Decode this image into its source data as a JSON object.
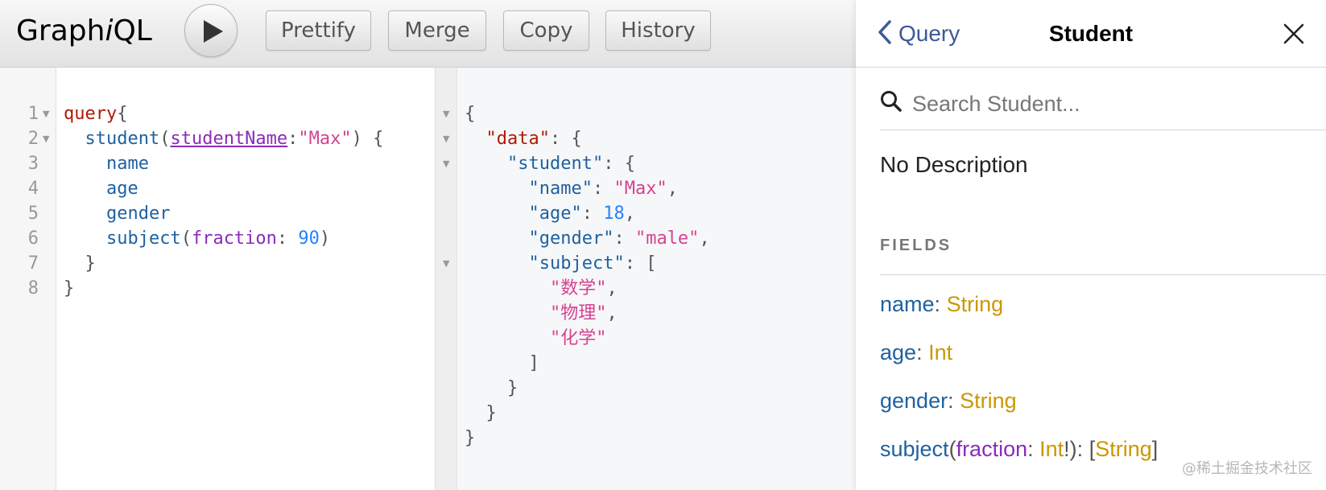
{
  "toolbar": {
    "logo_pre": "Graph",
    "logo_i": "i",
    "logo_post": "QL",
    "buttons": {
      "prettify": "Prettify",
      "merge": "Merge",
      "copy": "Copy",
      "history": "History"
    }
  },
  "query_editor": {
    "line_numbers": [
      "1",
      "2",
      "3",
      "4",
      "5",
      "6",
      "7",
      "8"
    ],
    "lines": {
      "l1_kw": "query",
      "l1_brace": "{",
      "l2_field": "student",
      "l2_open": "(",
      "l2_arg": "studentName",
      "l2_colon": ":",
      "l2_val": "\"Max\"",
      "l2_close": ") {",
      "l3": "name",
      "l4": "age",
      "l5": "gender",
      "l6_field": "subject",
      "l6_open": "(",
      "l6_arg": "fraction",
      "l6_colon": ": ",
      "l6_val": "90",
      "l6_close": ")",
      "l7": "}",
      "l8": "}"
    }
  },
  "result": {
    "open": "{",
    "data_key": "\"data\"",
    "colon": ": ",
    "brace_open": "{",
    "student_key": "\"student\"",
    "name_key": "\"name\"",
    "name_val": "\"Max\"",
    "age_key": "\"age\"",
    "age_val": "18",
    "gender_key": "\"gender\"",
    "gender_val": "\"male\"",
    "subject_key": "\"subject\"",
    "bracket_open": "[",
    "subjects": [
      "\"数学\"",
      "\"物理\"",
      "\"化学\""
    ],
    "comma": ",",
    "bracket_close": "]",
    "brace_close": "}"
  },
  "docs": {
    "back_label": "Query",
    "title": "Student",
    "search_placeholder": "Search Student...",
    "description": "No Description",
    "fields_heading": "FIELDS",
    "fields": [
      {
        "name": "name",
        "type": "String"
      },
      {
        "name": "age",
        "type": "Int"
      },
      {
        "name": "gender",
        "type": "String"
      },
      {
        "name": "subject",
        "arg": "fraction",
        "arg_type": "Int",
        "nonnull": "!",
        "type": "String"
      }
    ],
    "colon": ": ",
    "paren_open": "(",
    "paren_close": ")",
    "list_open": "[",
    "list_close": "]"
  },
  "watermark": "@稀土掘金技术社区"
}
